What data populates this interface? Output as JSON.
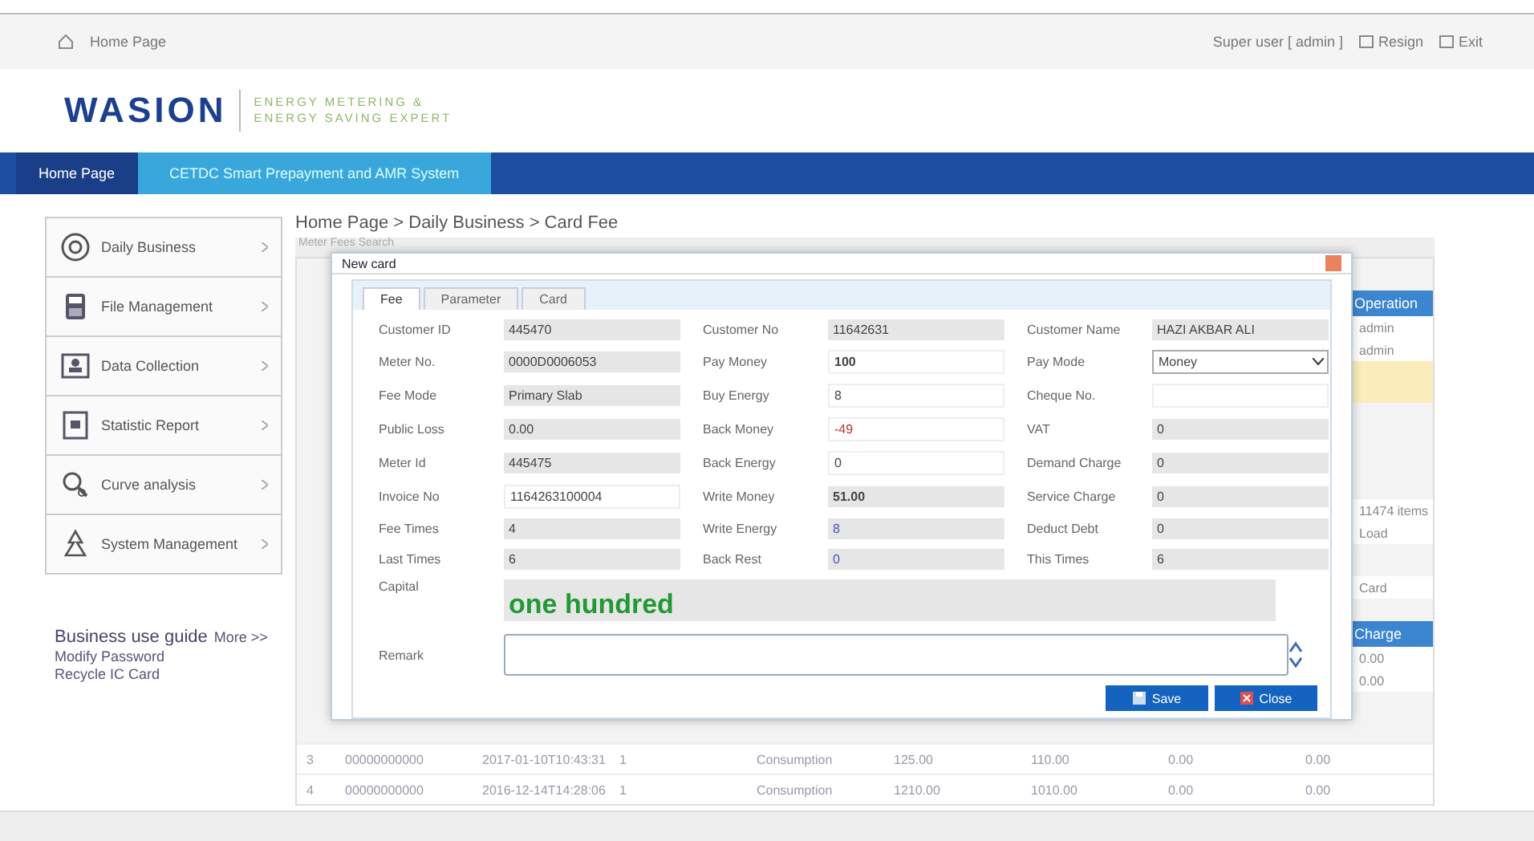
{
  "top_bar": {
    "location": "Home Page",
    "user": "Super user [ admin ]",
    "actions": [
      {
        "label": "Resign"
      },
      {
        "label": "Exit"
      }
    ]
  },
  "logo": {
    "name": "WASION",
    "tagline": [
      "ENERGY METERING &",
      "ENERGY SAVING EXPERT"
    ]
  },
  "nav": [
    {
      "label": "Home Page",
      "selected": true
    },
    {
      "label": "CETDC Smart Prepayment and AMR System",
      "selected": false
    }
  ],
  "sidebar": {
    "items": [
      {
        "label": "Daily Business"
      },
      {
        "label": "File Management"
      },
      {
        "label": "Data Collection"
      },
      {
        "label": "Statistic Report"
      },
      {
        "label": "Curve analysis"
      },
      {
        "label": "System Management"
      }
    ]
  },
  "guide": {
    "title": "Business use guide",
    "more": "More >>",
    "links": [
      "Modify Password",
      "Recycle IC Card"
    ]
  },
  "breadcrumb": "Home Page > Daily Business > Card Fee",
  "search_title": "Meter Fees Search",
  "background_table": {
    "header": "Operation",
    "rows": [
      "admin",
      "admin"
    ],
    "count": "11474 items",
    "load": "Load",
    "section": "Card",
    "header_2": "Charge",
    "cells": [
      "0.00",
      "0.00"
    ],
    "rows_2": [
      [
        "3",
        "00000000000",
        "2017-01-10T10:43:31",
        "1",
        "Consumption",
        "125.00",
        "110.00",
        "0.00",
        "0.00"
      ],
      [
        "4",
        "00000000000",
        "2016-12-14T14:28:06",
        "1",
        "Consumption",
        "1210.00",
        "1010.00",
        "0.00",
        "0.00"
      ]
    ]
  },
  "dialog": {
    "title": "New card",
    "tabs": [
      {
        "label": "Fee",
        "selected": true
      },
      {
        "label": "Parameter",
        "selected": false
      },
      {
        "label": "Card",
        "selected": false
      }
    ],
    "fields": [
      {
        "label": "Customer ID",
        "value": "445470",
        "kind": "readonly"
      },
      {
        "label": "Customer No",
        "value": "11642631",
        "kind": "readonly"
      },
      {
        "label": "Customer Name",
        "value": "HAZI AKBAR ALI",
        "kind": "readonly"
      },
      {
        "label": "Meter No.",
        "value": "0000D0006053",
        "kind": "readonly"
      },
      {
        "label": "Pay Money",
        "value": "100",
        "kind": "input",
        "bold": true
      },
      {
        "label": "Pay Mode",
        "value": "Money",
        "kind": "select"
      },
      {
        "label": "Fee Mode",
        "value": "Primary Slab",
        "kind": "readonly"
      },
      {
        "label": "Buy Energy",
        "value": "8",
        "kind": "input"
      },
      {
        "label": "Cheque No.",
        "kind": "input"
      },
      {
        "label": "Public Loss",
        "value": "0.00",
        "kind": "readonly"
      },
      {
        "label": "Back Money",
        "value": "-49",
        "kind": "input",
        "color": "#c03030"
      },
      {
        "label": "VAT",
        "value": "0",
        "kind": "readonly"
      },
      {
        "label": "Meter Id",
        "value": "445475",
        "kind": "readonly"
      },
      {
        "label": "Back Energy",
        "value": "0",
        "kind": "input"
      },
      {
        "label": "Demand Charge",
        "value": "0",
        "kind": "readonly"
      },
      {
        "label": "Invoice No",
        "value": "1164263100004",
        "kind": "input"
      },
      {
        "label": "Write Money",
        "value": "51.00",
        "kind": "readonly",
        "bold": true
      },
      {
        "label": "Service Charge",
        "value": "0",
        "kind": "readonly"
      },
      {
        "label": "Fee Times",
        "value": "4",
        "kind": "readonly"
      },
      {
        "label": "Write Energy",
        "value": "8",
        "kind": "readonly",
        "color": "#4450c8"
      },
      {
        "label": "Deduct Debt",
        "value": "0",
        "kind": "readonly"
      },
      {
        "label": "Last Times",
        "value": "6",
        "kind": "readonly"
      },
      {
        "label": "Back Rest",
        "value": "0",
        "kind": "readonly",
        "color": "#4450c8"
      },
      {
        "label": "This Times",
        "value": "6",
        "kind": "readonly"
      }
    ],
    "capital": {
      "label": "Capital",
      "value": "one hundred"
    },
    "remark": {
      "label": "Remark"
    },
    "buttons": [
      {
        "label": "Save",
        "kind": "save"
      },
      {
        "label": "Close",
        "kind": "close"
      }
    ]
  }
}
